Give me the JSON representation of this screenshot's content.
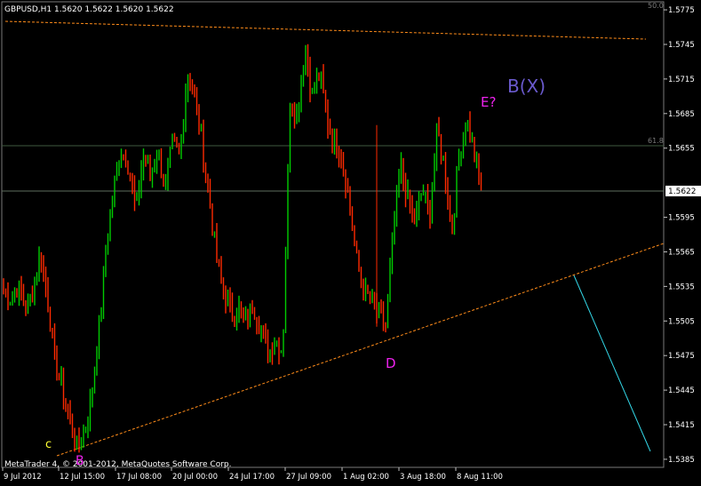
{
  "header": {
    "symbol_line": "GBPUSD,H1  1.5620 1.5622 1.5620 1.5622"
  },
  "footer": {
    "copyright": "MetaTrader 4, © 2001-2012, MetaQuotes Software Corp."
  },
  "fib": {
    "label_top": "50.0",
    "label_mid": "61.8"
  },
  "current_price": "1.5622",
  "price_axis": {
    "ticks": [
      "1.5775",
      "1.5745",
      "1.5715",
      "1.5685",
      "1.5655",
      "1.5622",
      "1.5595",
      "1.5565",
      "1.5535",
      "1.5505",
      "1.5475",
      "1.5445",
      "1.5415",
      "1.5385"
    ]
  },
  "time_axis": {
    "ticks": [
      "9 Jul 2012",
      "12 Jul 15:00",
      "17 Jul 08:00",
      "20 Jul 00:00",
      "24 Jul 17:00",
      "27 Jul 09:00",
      "1 Aug 02:00",
      "3 Aug 18:00",
      "8 Aug 11:00"
    ]
  },
  "wave_labels": {
    "c": "c",
    "B": "B",
    "D": "D",
    "E": "E?",
    "BX": "B(X)"
  },
  "colors": {
    "background": "#000000",
    "bull": "#00cc00",
    "bear": "#ff2a00",
    "trendline": "#ff8c1a",
    "projection": "#33d6e6",
    "fib_line": "#3f5a3f",
    "price_line": "#5e6e5e",
    "axis": "#c0c0c0",
    "label_magenta": "#ee22ee",
    "label_yellow": "#ffff33",
    "label_bx": "#6a5acd"
  },
  "chart_data": {
    "type": "candlestick",
    "symbol": "GBPUSD",
    "timeframe": "H1",
    "ylim": [
      1.5378,
      1.5782
    ],
    "close_path": [
      [
        "9 Jul 2012",
        1.553
      ],
      [
        "",
        1.5525
      ],
      [
        "",
        1.5535
      ],
      [
        "",
        1.5515
      ],
      [
        "",
        1.553
      ],
      [
        "",
        1.5565
      ],
      [
        "",
        1.5525
      ],
      [
        "",
        1.547
      ],
      [
        "",
        1.5445
      ],
      [
        "",
        1.542
      ],
      [
        "",
        1.5395
      ],
      [
        "",
        1.541
      ],
      [
        "",
        1.544
      ],
      [
        "12 Jul 15:00",
        1.55
      ],
      [
        "",
        1.557
      ],
      [
        "",
        1.562
      ],
      [
        "",
        1.5655
      ],
      [
        "",
        1.564
      ],
      [
        "",
        1.56
      ],
      [
        "",
        1.565
      ],
      [
        "17 Jul 08:00",
        1.563
      ],
      [
        "",
        1.5655
      ],
      [
        "",
        1.562
      ],
      [
        "",
        1.566
      ],
      [
        "",
        1.565
      ],
      [
        "",
        1.572
      ],
      [
        "",
        1.57
      ],
      [
        "",
        1.566
      ],
      [
        "",
        1.561
      ],
      [
        "20 Jul 00:00",
        1.556
      ],
      [
        "",
        1.553
      ],
      [
        "",
        1.551
      ],
      [
        "",
        1.5515
      ],
      [
        "",
        1.5505
      ],
      [
        "",
        1.552
      ],
      [
        "",
        1.55
      ],
      [
        "24 Jul 17:00",
        1.5475
      ],
      [
        "",
        1.549
      ],
      [
        "",
        1.548
      ],
      [
        "",
        1.57
      ],
      [
        "",
        1.568
      ],
      [
        "27 Jul 09:00",
        1.5745
      ],
      [
        "",
        1.57
      ],
      [
        "",
        1.572
      ],
      [
        "",
        1.568
      ],
      [
        "",
        1.566
      ],
      [
        "",
        1.565
      ],
      [
        "",
        1.561
      ],
      [
        "",
        1.556
      ],
      [
        "",
        1.553
      ],
      [
        "1 Aug 02:00",
        1.5525
      ],
      [
        "",
        1.551
      ],
      [
        "",
        1.55
      ],
      [
        "",
        1.558
      ],
      [
        "",
        1.564
      ],
      [
        "",
        1.561
      ],
      [
        "",
        1.559
      ],
      [
        "3 Aug 18:00",
        1.562
      ],
      [
        "",
        1.5595
      ],
      [
        "",
        1.567
      ],
      [
        "",
        1.564
      ],
      [
        "",
        1.558
      ],
      [
        "",
        1.565
      ],
      [
        "8 Aug 11:00",
        1.568
      ],
      [
        "",
        1.565
      ],
      [
        "",
        1.5622
      ]
    ],
    "lines": [
      {
        "name": "upper dotted trendline",
        "from": [
          "9 Jul 2012",
          1.5772
        ],
        "to": [
          "8 Aug 11:00+",
          1.5753
        ]
      },
      {
        "name": "lower dotted trendline",
        "from": [
          "12 Jul 15:00",
          1.539
        ],
        "to": [
          "right edge",
          1.5578
        ]
      },
      {
        "name": "projection",
        "from": [
          1.555
        ],
        "to": [
          1.5395
        ]
      }
    ],
    "annotations": [
      "c",
      "B",
      "D",
      "E?",
      "B(X)"
    ]
  }
}
